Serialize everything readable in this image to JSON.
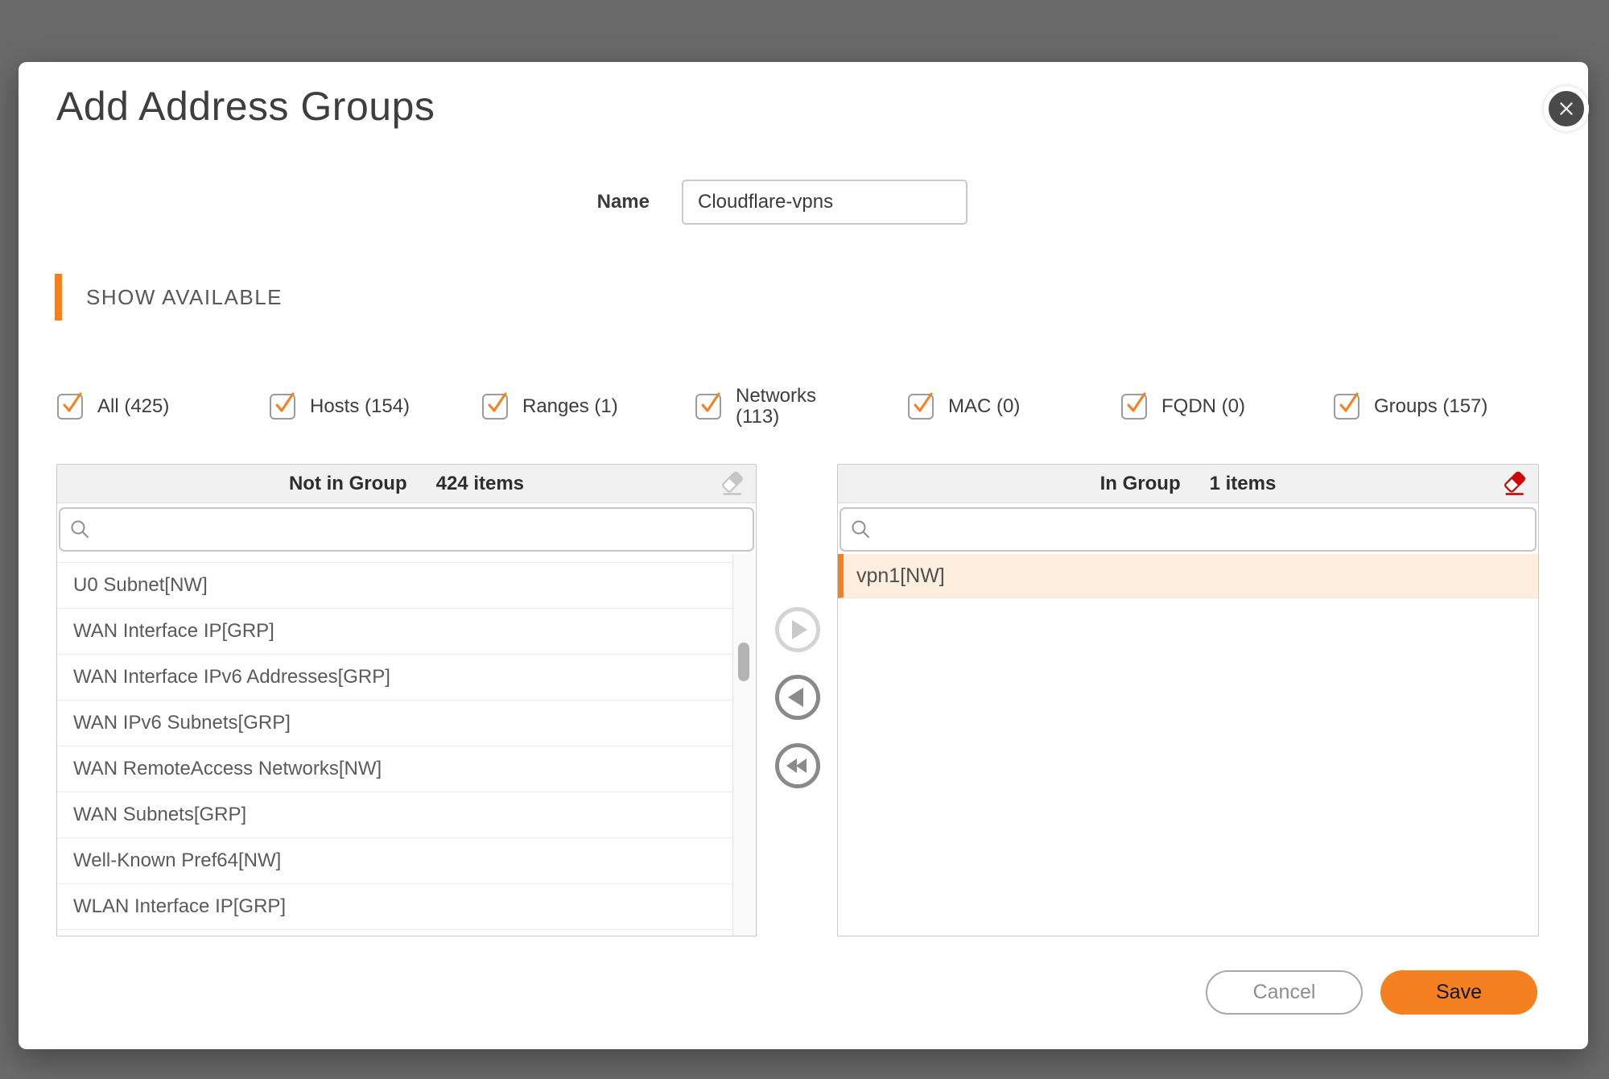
{
  "modal": {
    "title": "Add Address Groups",
    "name_field": {
      "label": "Name",
      "value": "Cloudflare-vpns"
    },
    "section_header": "SHOW AVAILABLE",
    "filters": [
      {
        "label": "All (425)",
        "checked": true
      },
      {
        "label": "Hosts (154)",
        "checked": true
      },
      {
        "label": "Ranges (1)",
        "checked": true
      },
      {
        "label": "Networks (113)",
        "checked": true
      },
      {
        "label": "MAC (0)",
        "checked": true
      },
      {
        "label": "FQDN (0)",
        "checked": true
      },
      {
        "label": "Groups (157)",
        "checked": true
      }
    ],
    "left_panel": {
      "title": "Not in Group",
      "count": "424 items",
      "search_value": "",
      "items": [
        "U0 Subnet[NW]",
        "WAN Interface IP[GRP]",
        "WAN Interface IPv6 Addresses[GRP]",
        "WAN IPv6 Subnets[GRP]",
        "WAN RemoteAccess Networks[NW]",
        "WAN Subnets[GRP]",
        "Well-Known Pref64[NW]",
        "WLAN Interface IP[GRP]"
      ]
    },
    "right_panel": {
      "title": "In Group",
      "count": "1 items",
      "search_value": "",
      "items": [
        "vpn1[NW]"
      ]
    },
    "footer": {
      "cancel_label": "Cancel",
      "save_label": "Save"
    },
    "colors": {
      "accent": "#f5801f",
      "eraser_red": "#cf0606",
      "selected_row_bg": "#fdeede",
      "backdrop": "#6a6a6a"
    }
  }
}
